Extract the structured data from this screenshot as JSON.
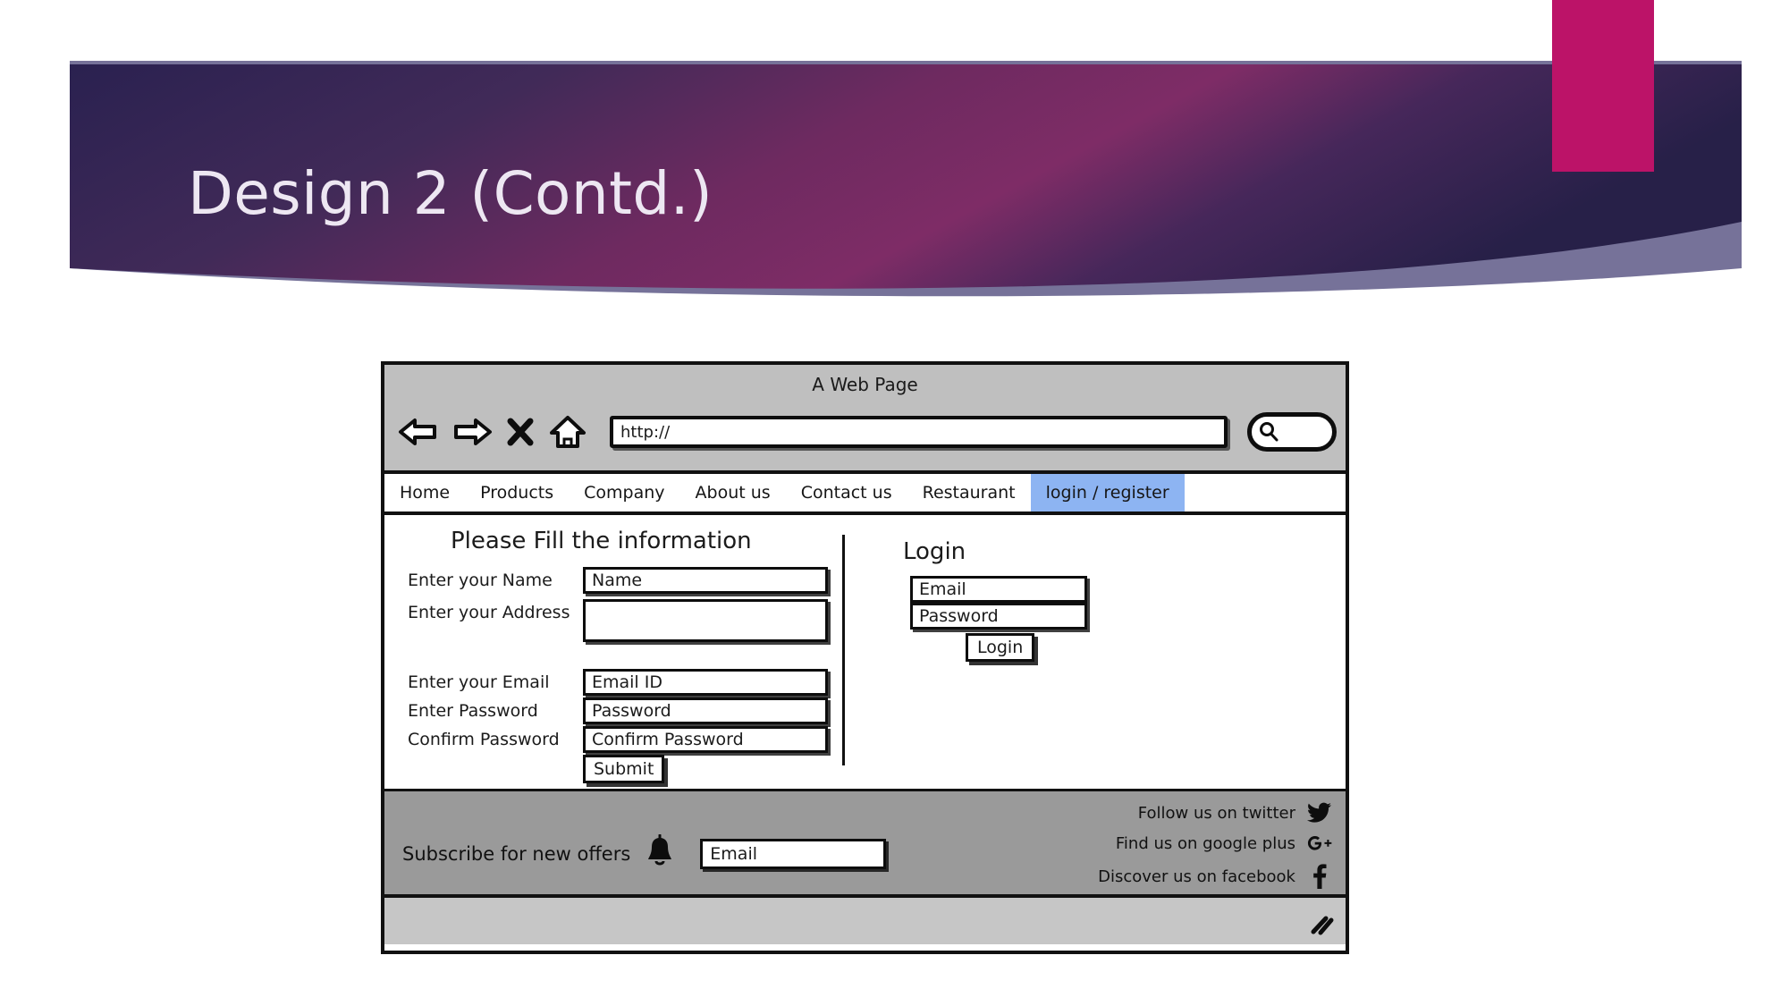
{
  "slide": {
    "title": "Design 2 (Contd.)",
    "accent_color": "#BC1368",
    "banner_dark": "#262048",
    "banner_purple": "#7A2A63",
    "banner_curve": "#6F6A93",
    "title_color": "#EDE7F2"
  },
  "browser": {
    "window_title": "A Web Page",
    "toolbar": {
      "back_icon": "back-arrow-icon",
      "forward_icon": "forward-arrow-icon",
      "stop_icon": "close-x-icon",
      "home_icon": "home-icon",
      "url_value": "http://",
      "search_icon": "search-magnifier-icon"
    },
    "nav": {
      "items": [
        {
          "label": "Home",
          "active": false
        },
        {
          "label": "Products",
          "active": false
        },
        {
          "label": "Company",
          "active": false
        },
        {
          "label": "About us",
          "active": false
        },
        {
          "label": "Contact us",
          "active": false
        },
        {
          "label": "Restaurant",
          "active": false
        },
        {
          "label": "login / register",
          "active": true
        }
      ],
      "active_bg": "#8DB4F2"
    }
  },
  "register": {
    "heading": "Please Fill the information",
    "fields": [
      {
        "label": "Enter your Name",
        "value": "Name"
      },
      {
        "label": "Enter your Address",
        "value": ""
      },
      {
        "label": "Enter your Email",
        "value": "Email ID"
      },
      {
        "label": "Enter Password",
        "value": "Password"
      },
      {
        "label": "Confirm Password",
        "value": "Confirm Password"
      }
    ],
    "submit_label": "Submit"
  },
  "login": {
    "heading": "Login",
    "email_value": "Email",
    "password_value": "Password",
    "button_label": "Login"
  },
  "footer": {
    "subscribe_label": "Subscribe for new offers",
    "bell_icon": "bell-icon",
    "subscribe_input_value": "Email",
    "social": [
      {
        "label": "Follow us on twitter",
        "icon": "twitter-icon"
      },
      {
        "label": "Find us on google plus",
        "icon": "google-plus-icon"
      },
      {
        "label": "Discover us on facebook",
        "icon": "facebook-icon"
      }
    ],
    "bg_color": "#9A9A9A"
  },
  "statusbar": {
    "resize_grip_icon": "resize-grip-icon",
    "bg_color": "#C6C6C6"
  }
}
